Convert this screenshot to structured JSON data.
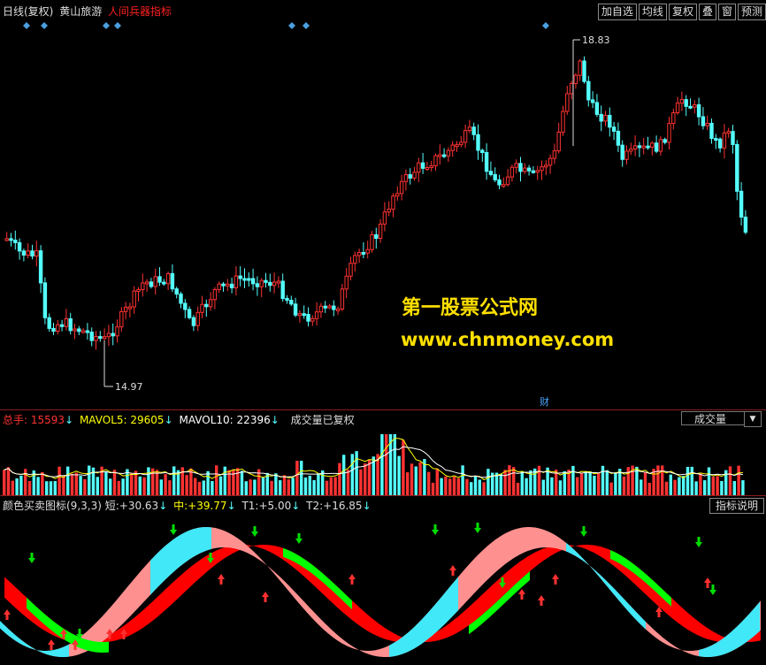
{
  "main": {
    "period": "日线(复权)",
    "stock_name": "黄山旅游",
    "indicator_name": "人间兵器指标",
    "buttons": [
      "加自选",
      "均线",
      "复权",
      "叠",
      "窗",
      "预测"
    ],
    "high_label": "18.83",
    "low_label": "14.97",
    "finance_mark": "财",
    "watermark_title": "第一股票公式网",
    "watermark_url": "www.chnmoney.com",
    "price_range": [
      14.5,
      19.4
    ]
  },
  "volume": {
    "total_label": "总手:",
    "total_value": "15593",
    "mavol5_label": "MAVOL5:",
    "mavol5_value": "29605",
    "mavol10_label": "MAVOL10:",
    "mavol10_value": "22396",
    "note": "成交量已复权",
    "selector_value": "成交量"
  },
  "indicator": {
    "name": "颜色买卖图标(9,3,3)",
    "short_label": "短:",
    "short_value": "+30.63",
    "mid_label": "中:",
    "mid_value": "+39.77",
    "t1_label": "T1:",
    "t1_value": "+5.00",
    "t2_label": "T2:",
    "t2_value": "+16.85",
    "help_button": "指标说明"
  },
  "colors": {
    "up": "#ff3232",
    "down": "#54ffff",
    "panel_border": "#8a1c1c",
    "mavol5": "#ffff00",
    "mavol10": "#ffffff",
    "band_red": "#ff0000",
    "band_green": "#00ff00",
    "band_pink": "#ff9090",
    "band_cyan": "#40e8f8",
    "arrow_up": "#ff3030",
    "arrow_down": "#00dd00"
  },
  "arrow_icons": [
    "down-arrow-icon",
    "up-arrow-icon"
  ]
}
